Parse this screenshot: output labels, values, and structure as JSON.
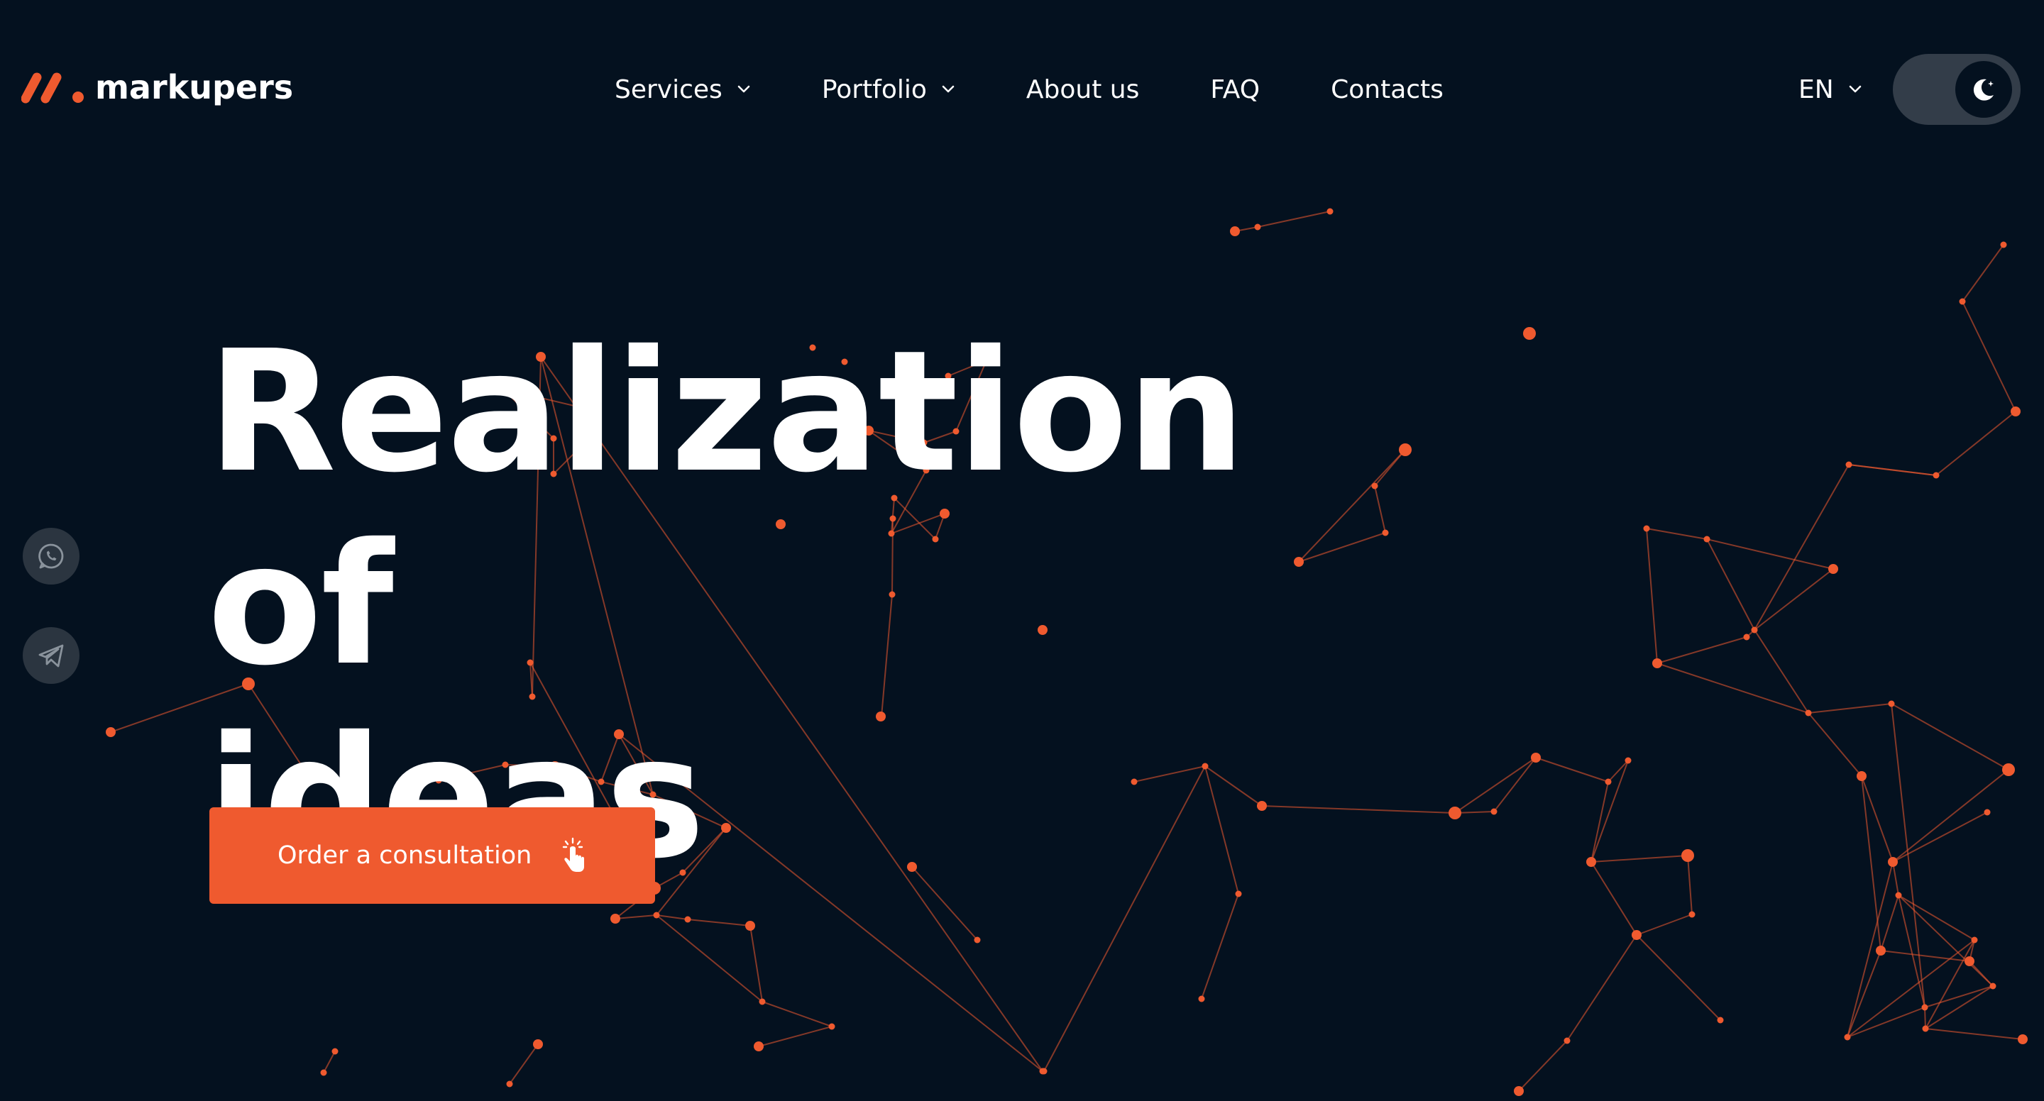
{
  "brand": {
    "name": "markupers",
    "accent_color": "#ef5a2f",
    "background_color": "#04111f"
  },
  "nav": {
    "items": [
      {
        "label": "Services",
        "has_dropdown": true
      },
      {
        "label": "Portfolio",
        "has_dropdown": true
      },
      {
        "label": "About us",
        "has_dropdown": false
      },
      {
        "label": "FAQ",
        "has_dropdown": false
      },
      {
        "label": "Contacts",
        "has_dropdown": false
      }
    ]
  },
  "language": {
    "selected": "EN"
  },
  "theme_toggle": {
    "mode": "dark",
    "icon": "moon-icon"
  },
  "social": {
    "items": [
      {
        "name": "whatsapp",
        "icon": "whatsapp-icon"
      },
      {
        "name": "telegram",
        "icon": "telegram-icon"
      }
    ]
  },
  "hero": {
    "title_line1": "Realization of",
    "title_line2": "ideas",
    "cta_label": "Order a consultation",
    "cta_icon": "hand-pointer-icon"
  },
  "background": {
    "decoration": "network-of-nodes",
    "node_color": "#ef5a2f"
  }
}
